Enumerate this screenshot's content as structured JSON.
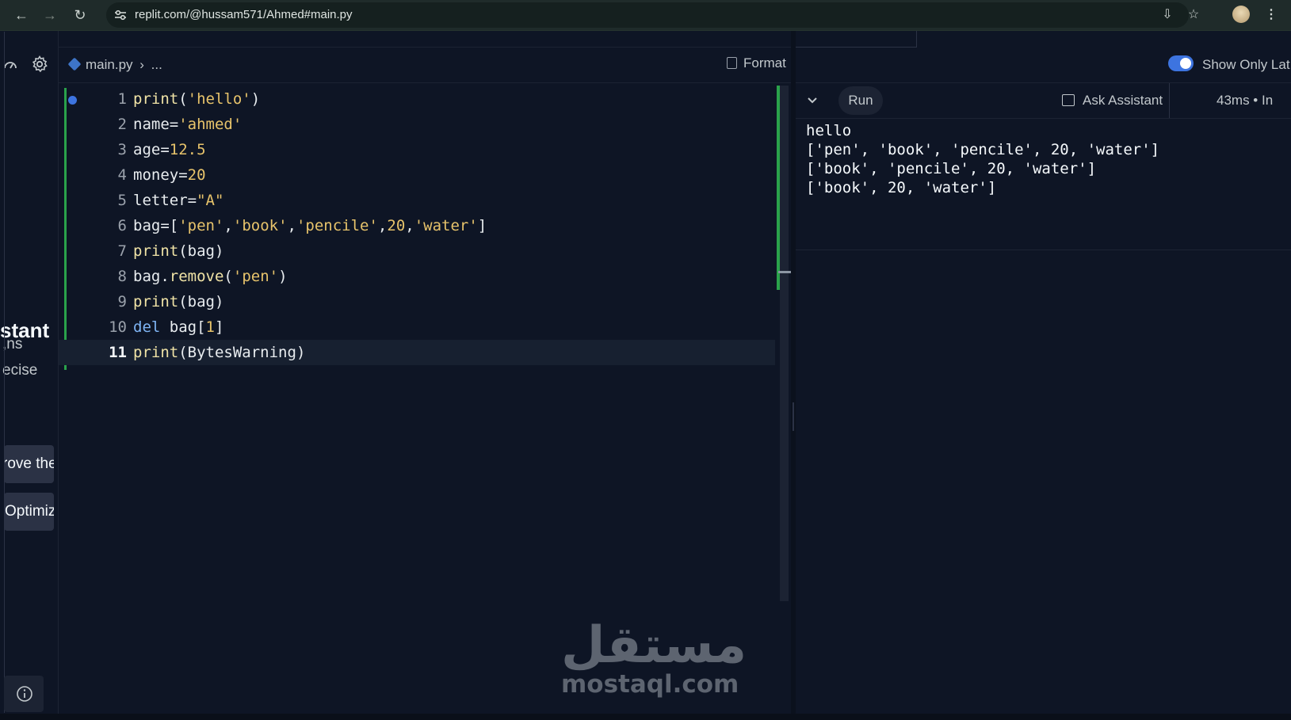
{
  "browser": {
    "url": "replit.com/@hussam571/Ahmed#main.py"
  },
  "sidebar": {
    "assistant_heading": "stant",
    "text_line_1": "ns,",
    "text_line_2": "ecise",
    "chip_1": "rove the",
    "chip_2": "Optimiz"
  },
  "editor": {
    "breadcrumb_file": "main.py",
    "breadcrumb_sep": "›",
    "breadcrumb_more": "...",
    "format_label": "Format",
    "lines": [
      {
        "num": "1"
      },
      {
        "num": "2"
      },
      {
        "num": "3"
      },
      {
        "num": "4"
      },
      {
        "num": "5"
      },
      {
        "num": "6"
      },
      {
        "num": "7"
      },
      {
        "num": "8"
      },
      {
        "num": "9"
      },
      {
        "num": "10"
      },
      {
        "num": "11"
      }
    ],
    "active_line": 11,
    "code": [
      "print('hello')",
      "name='ahmed'",
      "age=12.5",
      "money=20",
      "letter=\"A\"",
      "bag=['pen','book','pencile',20,'water']",
      "print(bag)",
      "bag.remove('pen')",
      "print(bag)",
      "del bag[1]",
      "print(BytesWarning)"
    ]
  },
  "console": {
    "toggle_label": "Show Only Lat",
    "run_label": "Run",
    "ask_assistant_label": "Ask Assistant",
    "timing": "43ms • In",
    "output": [
      "hello",
      "['pen', 'book', 'pencile', 20, 'water']",
      "['book', 'pencile', 20, 'water']",
      "['book', 20, 'water']"
    ]
  },
  "watermark": {
    "arabic": "مستقل",
    "domain": "mostaql.com"
  },
  "colors": {
    "background": "#0e1525",
    "accent": "#3d74e0",
    "change_marker": "#2aa24b"
  }
}
